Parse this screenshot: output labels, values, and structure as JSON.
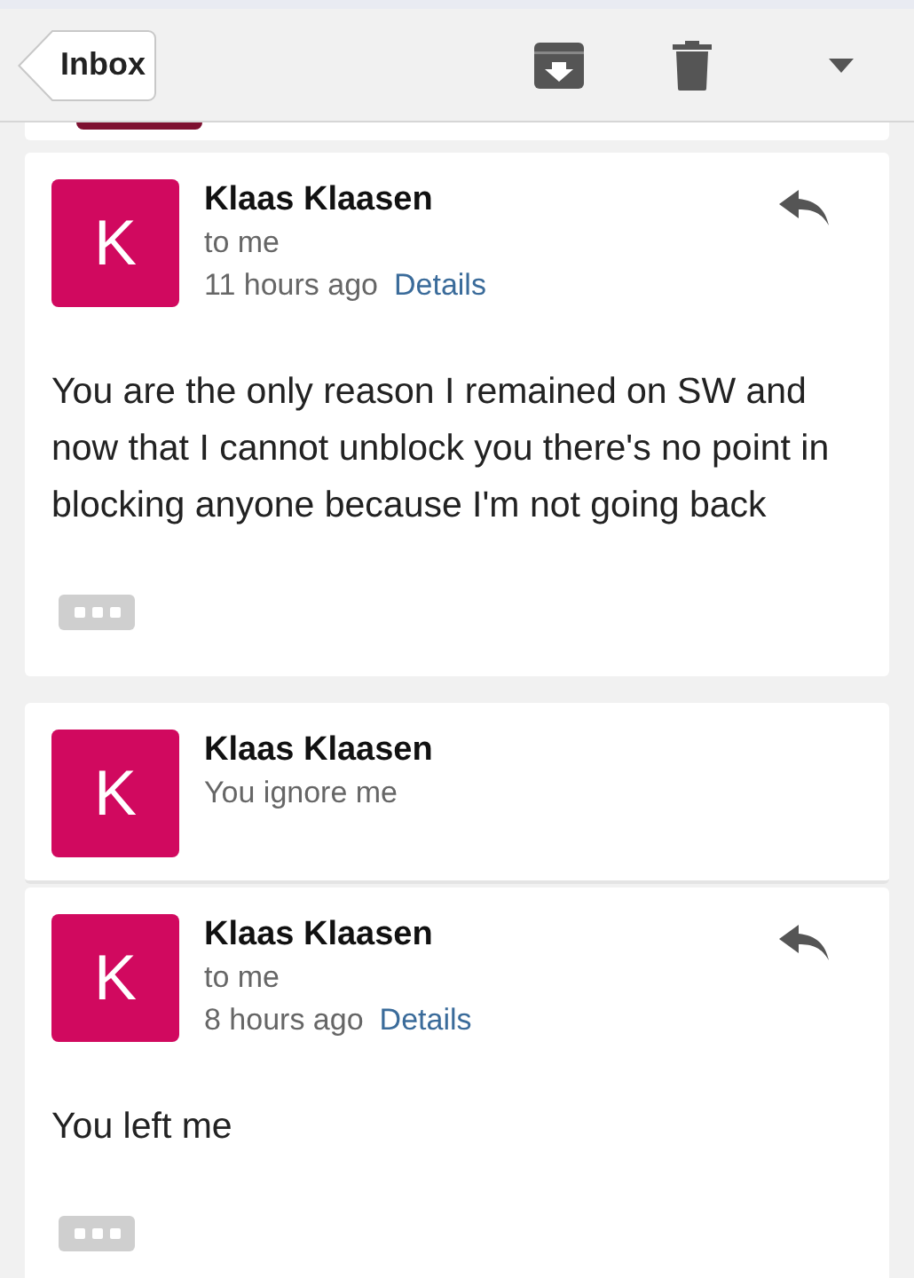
{
  "toolbar": {
    "back_label": "Inbox"
  },
  "messages": [
    {
      "kind": "cut"
    },
    {
      "kind": "expanded",
      "initial": "K",
      "sender": "Klaas Klaasen",
      "recipient": "to me",
      "time": "11 hours ago",
      "details_link": "Details",
      "body": "You are the only reason I remained on SW and now that I cannot unblock you there's no point in blocking anyone because I'm not going back"
    },
    {
      "kind": "collapsed",
      "initial": "K",
      "sender": "Klaas Klaasen",
      "snippet": "You ignore me"
    },
    {
      "kind": "expanded",
      "initial": "K",
      "sender": "Klaas Klaasen",
      "recipient": "to me",
      "time": "8 hours ago",
      "details_link": "Details",
      "body": "You left me"
    }
  ]
}
